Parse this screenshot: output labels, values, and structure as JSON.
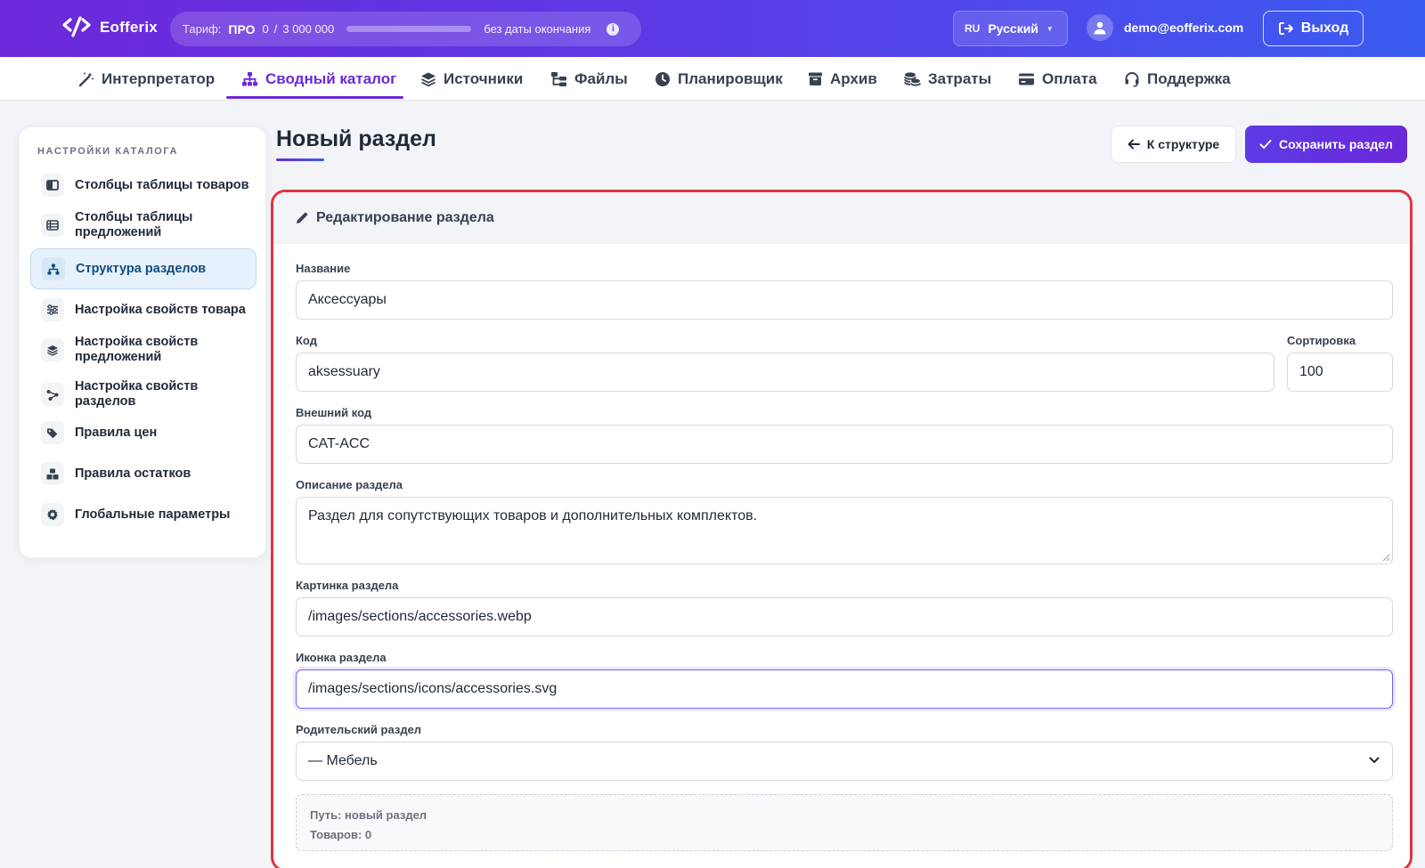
{
  "app": {
    "name": "Eofferix"
  },
  "plan": {
    "label": "Тариф:",
    "name": "ПРО",
    "used": "0",
    "sep": "/",
    "limit": "3 000 000",
    "usage_fraction": 0,
    "no_end": "без даты окончания"
  },
  "lang": {
    "code": "RU",
    "name": "Русский"
  },
  "user": {
    "email": "demo@eofferix.com"
  },
  "logout_label": "Выход",
  "nav": [
    {
      "label": "Интерпретатор",
      "icon": "wand-icon"
    },
    {
      "label": "Сводный каталог",
      "icon": "sitemap-icon",
      "active": true
    },
    {
      "label": "Источники",
      "icon": "layers-icon"
    },
    {
      "label": "Файлы",
      "icon": "folder-tree-icon"
    },
    {
      "label": "Планировщик",
      "icon": "clock-icon"
    },
    {
      "label": "Архив",
      "icon": "archive-icon"
    },
    {
      "label": "Затраты",
      "icon": "coins-icon"
    },
    {
      "label": "Оплата",
      "icon": "credit-card-icon"
    },
    {
      "label": "Поддержка",
      "icon": "headset-icon"
    }
  ],
  "sidebar": {
    "heading": "НАСТРОЙКИ КАТАЛОГА",
    "items": [
      {
        "label": "Столбцы таблицы товаров",
        "icon": "columns-icon"
      },
      {
        "label": "Столбцы таблицы предложений",
        "icon": "table-list-icon"
      },
      {
        "label": "Структура разделов",
        "icon": "sitemap-icon",
        "active": true
      },
      {
        "label": "Настройка свойств товара",
        "icon": "sliders-icon"
      },
      {
        "label": "Настройка свойств предложений",
        "icon": "layer-group-icon"
      },
      {
        "label": "Настройка свойств разделов",
        "icon": "share-nodes-icon"
      },
      {
        "label": "Правила цен",
        "icon": "tags-icon"
      },
      {
        "label": "Правила остатков",
        "icon": "boxes-icon"
      },
      {
        "label": "Глобальные параметры",
        "icon": "gear-icon"
      }
    ]
  },
  "page": {
    "title": "Новый раздел",
    "back_label": "К структуре",
    "save_label": "Сохранить раздел"
  },
  "form": {
    "header": "Редактирование раздела",
    "name": {
      "label": "Название",
      "value": "Аксессуары"
    },
    "code": {
      "label": "Код",
      "value": "aksessuary"
    },
    "sort": {
      "label": "Сортировка",
      "value": "100"
    },
    "external_code": {
      "label": "Внешний код",
      "value": "CAT-ACC"
    },
    "description": {
      "label": "Описание раздела",
      "value": "Раздел для сопутствующих товаров и дополнительных комплектов."
    },
    "picture": {
      "label": "Картинка раздела",
      "value": "/images/sections/accessories.webp"
    },
    "icon": {
      "label": "Иконка раздела",
      "value": "/images/sections/icons/accessories.svg"
    },
    "parent": {
      "label": "Родительский раздел",
      "value": "— Мебель"
    },
    "info": {
      "path": "Путь: новый раздел",
      "count": "Товаров: 0"
    }
  },
  "colors": {
    "brand_from": "#6d28d9",
    "brand_to": "#3b5cf0",
    "highlight": "#e0343f",
    "active_bg": "#e6f1fb"
  }
}
